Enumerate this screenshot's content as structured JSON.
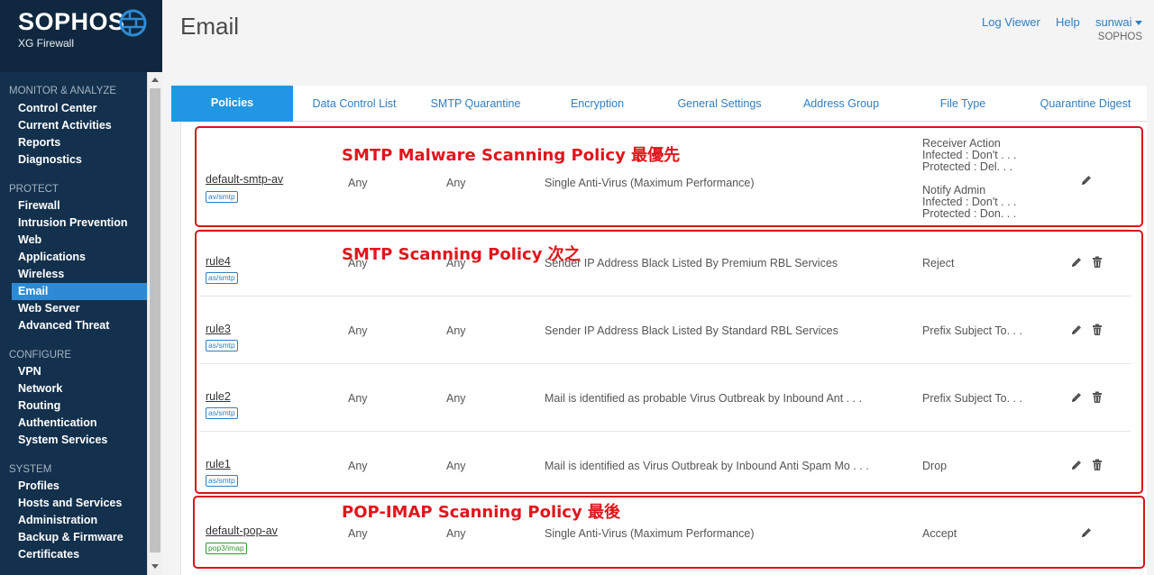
{
  "brand": {
    "name": "SOPHOS",
    "product": "XG Firewall"
  },
  "header": {
    "title": "Email",
    "log_viewer": "Log Viewer",
    "help": "Help",
    "user": "sunwai",
    "org": "SOPHOS"
  },
  "nav": {
    "monitor": {
      "label": "MONITOR & ANALYZE",
      "items": [
        "Control Center",
        "Current Activities",
        "Reports",
        "Diagnostics"
      ]
    },
    "protect": {
      "label": "PROTECT",
      "items": [
        "Firewall",
        "Intrusion Prevention",
        "Web",
        "Applications",
        "Wireless",
        "Email",
        "Web Server",
        "Advanced Threat"
      ]
    },
    "configure": {
      "label": "CONFIGURE",
      "items": [
        "VPN",
        "Network",
        "Routing",
        "Authentication",
        "System Services"
      ]
    },
    "system": {
      "label": "SYSTEM",
      "items": [
        "Profiles",
        "Hosts and Services",
        "Administration",
        "Backup & Firmware",
        "Certificates"
      ]
    },
    "active_item": "Email"
  },
  "tabs": [
    "Policies",
    "Data Control List",
    "SMTP Quarantine",
    "Encryption",
    "General Settings",
    "Address Group",
    "File Type",
    "Quarantine Digest"
  ],
  "active_tab": "Policies",
  "policies": [
    {
      "name": "default-smtp-av",
      "badge": "av/smtp",
      "source": "Any",
      "destination": "Any",
      "description": "Single Anti-Virus (Maximum Performance)",
      "action_lines": [
        "Receiver Action",
        "Infected : Don't . . .",
        "Protected : Del. . .",
        "",
        "Notify Admin",
        "Infected : Don't . . .",
        "Protected : Don. . ."
      ],
      "deletable": false
    },
    {
      "name": "rule4",
      "badge": "as/smtp",
      "source": "Any",
      "destination": "Any",
      "description": "Sender IP Address Black Listed By Premium RBL Services",
      "action": "Reject",
      "deletable": true
    },
    {
      "name": "rule3",
      "badge": "as/smtp",
      "source": "Any",
      "destination": "Any",
      "description": "Sender IP Address Black Listed By Standard RBL Services",
      "action": "Prefix Subject To. . .",
      "deletable": true
    },
    {
      "name": "rule2",
      "badge": "as/smtp",
      "source": "Any",
      "destination": "Any",
      "description": "Mail is identified as probable Virus Outbreak by Inbound Ant . . .",
      "action": "Prefix Subject To. . .",
      "deletable": true
    },
    {
      "name": "rule1",
      "badge": "as/smtp",
      "source": "Any",
      "destination": "Any",
      "description": "Mail is identified as Virus Outbreak by Inbound Anti Spam Mo . . .",
      "action": "Drop",
      "deletable": true
    },
    {
      "name": "default-pop-av",
      "badge": "pop3/imap",
      "source": "Any",
      "destination": "Any",
      "description": "Single Anti-Virus (Maximum Performance)",
      "action": "Accept",
      "deletable": false
    }
  ],
  "annotations": {
    "smtp_malware": "SMTP Malware Scanning Policy 最優先",
    "smtp_scanning": "SMTP Scanning Policy 次之",
    "pop_imap": "POP-IMAP Scanning Policy 最後"
  },
  "colors": {
    "sidebar": "#13304d",
    "active_nav": "#2d8bd6",
    "accent": "#2196e3",
    "link": "#2f7ec2",
    "annotation": "#d7141a"
  }
}
